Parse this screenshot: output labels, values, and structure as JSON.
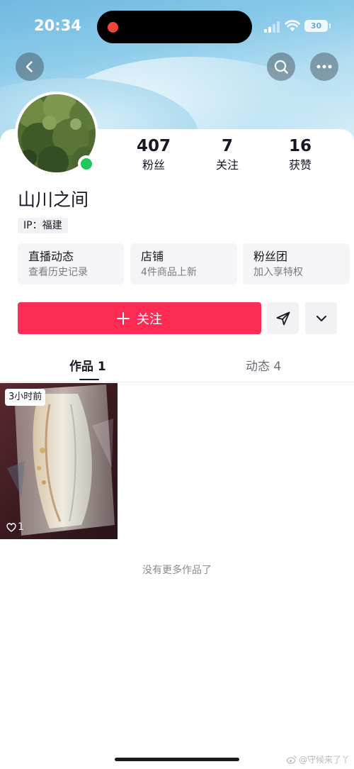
{
  "status_bar": {
    "time": "20:34",
    "battery": "30"
  },
  "colors": {
    "accent": "#fe2c55",
    "online": "#1cc95a"
  },
  "header": {
    "back_icon": "chevron-left-icon",
    "search_icon": "search-icon",
    "more_icon": "more-dots-icon"
  },
  "profile": {
    "name": "山川之间",
    "ip": "IP：福建",
    "stats": [
      {
        "value": "407",
        "label": "粉丝"
      },
      {
        "value": "7",
        "label": "关注"
      },
      {
        "value": "16",
        "label": "获赞"
      }
    ]
  },
  "cards": [
    {
      "title": "直播动态",
      "subtitle": "查看历史记录"
    },
    {
      "title": "店铺",
      "subtitle": "4件商品上新"
    },
    {
      "title": "粉丝团",
      "subtitle": "加入享特权"
    }
  ],
  "actions": {
    "follow_label": "关注"
  },
  "tabs": [
    {
      "label": "作品 1",
      "active": true
    },
    {
      "label": "动态 4",
      "active": false
    }
  ],
  "works": [
    {
      "time_tag": "3小时前",
      "likes": "1"
    }
  ],
  "footer": {
    "no_more": "没有更多作品了",
    "watermark": "@守候来了丫"
  }
}
